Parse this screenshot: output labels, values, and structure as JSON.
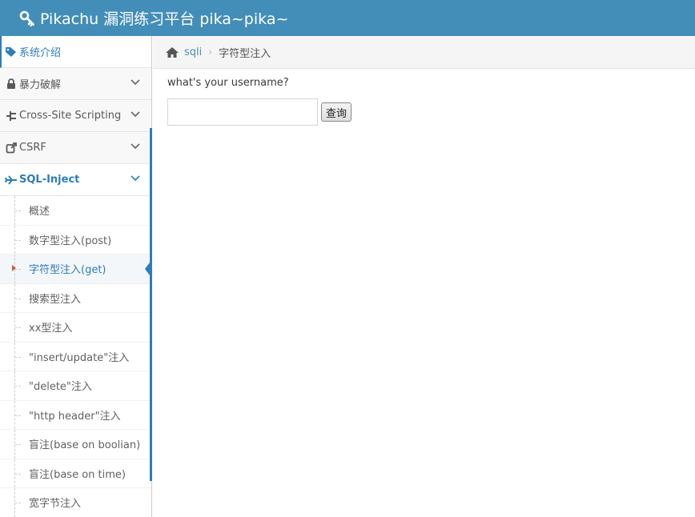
{
  "header": {
    "title": "Pikachu 漏洞练习平台 pika~pika~"
  },
  "sidebar": {
    "items": [
      {
        "label": "系统介绍"
      },
      {
        "label": "暴力破解"
      },
      {
        "label": "Cross-Site Scripting"
      },
      {
        "label": "CSRF"
      },
      {
        "label": "SQL-Inject"
      }
    ],
    "submenu": [
      "概述",
      "数字型注入(post)",
      "字符型注入(get)",
      "搜索型注入",
      "xx型注入",
      "\"insert/update\"注入",
      "\"delete\"注入",
      "\"http header\"注入",
      "盲注(base on boolian)",
      "盲注(base on time)",
      "宽字节注入"
    ],
    "active_sub_index": 2
  },
  "breadcrumb": {
    "link": "sqli",
    "current": "字符型注入"
  },
  "form": {
    "question": "what's your username?",
    "username_value": "",
    "submit_label": "查询"
  },
  "colors": {
    "header_bg": "#438eb9",
    "accent": "#2b7dbc"
  }
}
